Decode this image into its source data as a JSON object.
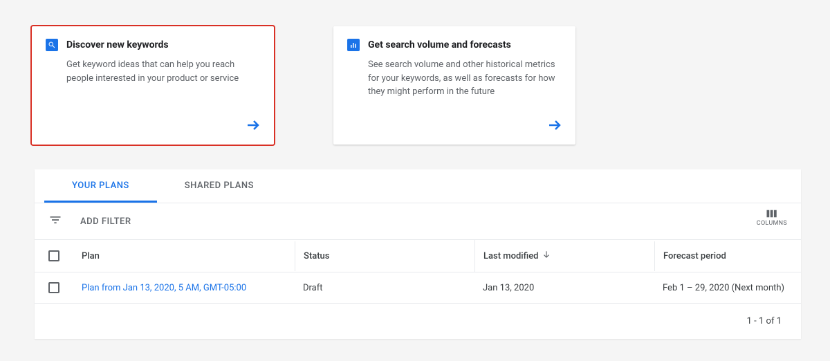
{
  "cards": {
    "discover": {
      "title": "Discover new keywords",
      "description": "Get keyword ideas that can help you reach people interested in your product or service"
    },
    "volume": {
      "title": "Get search volume and forecasts",
      "description": "See search volume and other historical metrics for your keywords, as well as forecasts for how they might perform in the future"
    }
  },
  "tabs": {
    "your_plans": "YOUR PLANS",
    "shared_plans": "SHARED PLANS"
  },
  "filter": {
    "add_label": "ADD FILTER",
    "columns_label": "COLUMNS"
  },
  "table": {
    "headers": {
      "plan": "Plan",
      "status": "Status",
      "last_modified": "Last modified",
      "forecast_period": "Forecast period"
    },
    "row": {
      "plan": "Plan from Jan 13, 2020, 5 AM, GMT-05:00",
      "status": "Draft",
      "last_modified": "Jan 13, 2020",
      "forecast_period": "Feb 1 – 29, 2020 (Next month)"
    },
    "footer": "1 - 1 of 1"
  }
}
